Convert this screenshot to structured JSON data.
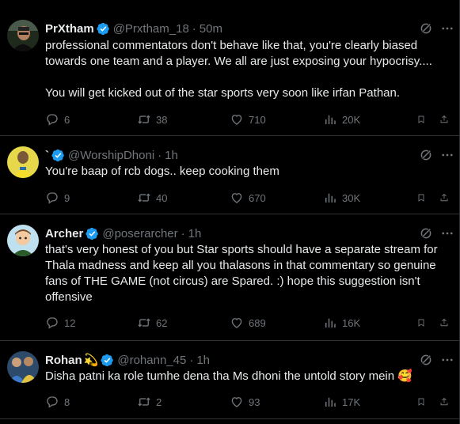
{
  "tweets": [
    {
      "name": "PrXtham",
      "handle": "@Prxtham_18",
      "time": "50m",
      "text": "professional commentators don't behave like that, you're clearly biased towards one team and a player. We all are just exposing your hypocrisy....\n\nYou will get kicked out of the star sports very soon like irfan Pathan.",
      "replies": "6",
      "reposts": "38",
      "likes": "710",
      "views": "20K"
    },
    {
      "name": "`",
      "handle": "@WorshipDhoni",
      "time": "1h",
      "text": "You're baap of rcb dogs.. keep cooking them",
      "replies": "9",
      "reposts": "40",
      "likes": "670",
      "views": "30K"
    },
    {
      "name": "Archer",
      "handle": "@poserarcher",
      "time": "1h",
      "text": "that's very honest of you but Star sports should have a separate stream for Thala madness and keep all you thalasons in that commentary so genuine fans of THE GAME (not circus) are Spared. :) hope this suggestion isn't offensive",
      "replies": "12",
      "reposts": "62",
      "likes": "689",
      "views": "16K"
    },
    {
      "name": "Rohan",
      "name_emoji": "💫",
      "handle": "@rohann_45",
      "time": "1h",
      "text": "Disha patni ka role tumhe dena tha Ms dhoni the untold story mein 🥰",
      "replies": "8",
      "reposts": "2",
      "likes": "93",
      "views": "17K"
    }
  ],
  "separator": "·",
  "colors": {
    "background": "#000000",
    "text": "#e7e9ea",
    "muted": "#71767b",
    "verified": "#1d9bf0",
    "divider": "#2f3336"
  },
  "icons": [
    "verified-badge-icon",
    "grok-icon",
    "more-icon",
    "reply-icon",
    "repost-icon",
    "like-icon",
    "views-icon",
    "bookmark-icon",
    "share-icon"
  ]
}
